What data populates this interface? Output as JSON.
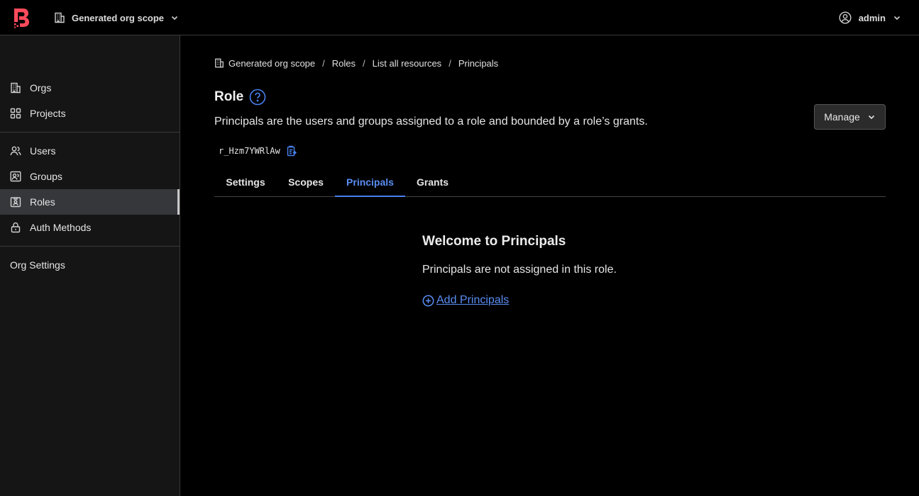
{
  "header": {
    "scope_label": "Generated org scope",
    "user_label": "admin",
    "brand_color": "#ff4b5c"
  },
  "sidebar": {
    "items": [
      {
        "label": "Orgs",
        "icon": "building-icon"
      },
      {
        "label": "Projects",
        "icon": "grid-icon"
      },
      {
        "label": "Users",
        "icon": "users-icon"
      },
      {
        "label": "Groups",
        "icon": "groups-icon"
      },
      {
        "label": "Roles",
        "icon": "id-badge-icon",
        "active": true
      },
      {
        "label": "Auth Methods",
        "icon": "lock-icon"
      }
    ],
    "org_settings": "Org Settings"
  },
  "breadcrumb": {
    "scope": "Generated org scope",
    "roles": "Roles",
    "list": "List all resources",
    "current": "Principals",
    "separator": "/"
  },
  "page": {
    "title": "Role",
    "subtitle": "Principals are the users and groups assigned to a role and bounded by a role’s grants.",
    "id": "r_Hzm7YWRlAw",
    "manage_label": "Manage"
  },
  "tabs": [
    {
      "label": "Settings"
    },
    {
      "label": "Scopes"
    },
    {
      "label": "Principals",
      "active": true
    },
    {
      "label": "Grants"
    }
  ],
  "empty_state": {
    "title": "Welcome to Principals",
    "message": "Principals are not assigned in this role.",
    "link_label": "Add Principals"
  },
  "colors": {
    "accent": "#5b8ef5",
    "background": "#000000",
    "sidebar": "#151515"
  }
}
